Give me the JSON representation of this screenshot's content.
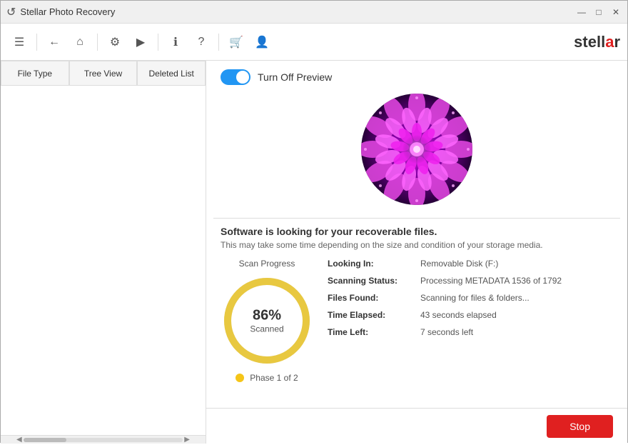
{
  "titlebar": {
    "icon": "↺",
    "title": "Stellar Photo Recovery",
    "minimize": "—",
    "maximize": "□",
    "close": "✕"
  },
  "toolbar": {
    "menu_icon": "☰",
    "back_icon": "←",
    "home_icon": "⌂",
    "settings_icon": "⚙",
    "play_icon": "▶",
    "info_icon": "ℹ",
    "help_icon": "?",
    "cart_icon": "🛒",
    "account_icon": "👤",
    "logo_text": "stell",
    "logo_highlight": "a",
    "logo_rest": "r"
  },
  "tabs": [
    {
      "label": "File Type",
      "active": false
    },
    {
      "label": "Tree View",
      "active": false
    },
    {
      "label": "Deleted List",
      "active": false
    }
  ],
  "preview": {
    "toggle_label": "Turn Off Preview"
  },
  "scan": {
    "title": "Software is looking for your recoverable files.",
    "subtitle": "This may take some time depending on the size and condition of your storage media.",
    "progress_label": "Scan Progress",
    "progress_percent": "86%",
    "progress_scanned": "Scanned",
    "phase_label": "Phase 1 of 2",
    "looking_in_key": "Looking In:",
    "looking_in_val": "Removable Disk (F:)",
    "scanning_status_key": "Scanning Status:",
    "scanning_status_val": "Processing METADATA 1536 of 1792",
    "files_found_key": "Files Found:",
    "files_found_val": "Scanning for files & folders...",
    "time_elapsed_key": "Time Elapsed:",
    "time_elapsed_val": "43 seconds elapsed",
    "time_left_key": "Time Left:",
    "time_left_val": "7 seconds left"
  },
  "bottom": {
    "stop_label": "Stop"
  },
  "colors": {
    "accent_red": "#e02020",
    "progress_yellow": "#e8c840",
    "progress_gray": "#888",
    "toggle_blue": "#2196F3"
  }
}
